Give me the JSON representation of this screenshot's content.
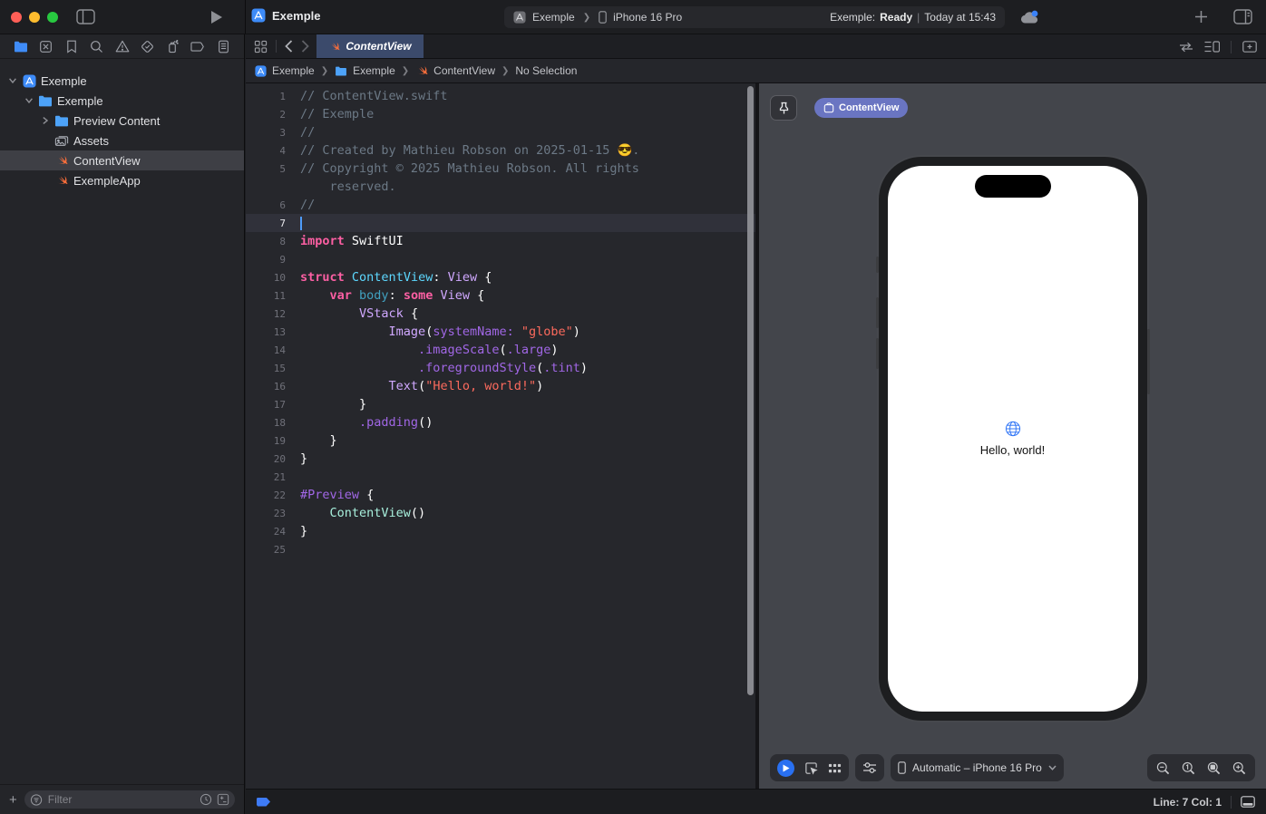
{
  "toolbar": {
    "project_title": "Exemple",
    "scheme_app": "Exemple",
    "scheme_chevron": "❯",
    "scheme_device": "iPhone 16 Pro",
    "status_project": "Exemple:",
    "status_state": "Ready",
    "status_sep": "|",
    "status_time": "Today at 15:43"
  },
  "navigator": {
    "icons": [
      "project-navigator-icon",
      "source-control-navigator-icon",
      "bookmarks-navigator-icon",
      "find-navigator-icon",
      "issues-navigator-icon",
      "tests-navigator-icon",
      "debug-navigator-icon",
      "breakpoints-navigator-icon",
      "reports-navigator-icon"
    ],
    "selected_index": 0
  },
  "sidebar": {
    "tree": [
      {
        "label": "Exemple",
        "icon": "app",
        "depth": 0,
        "chevron": "down",
        "selected": false
      },
      {
        "label": "Exemple",
        "icon": "folder",
        "depth": 1,
        "chevron": "down",
        "selected": false
      },
      {
        "label": "Preview Content",
        "icon": "folder",
        "depth": 2,
        "chevron": "right",
        "selected": false
      },
      {
        "label": "Assets",
        "icon": "assets",
        "depth": 2,
        "chevron": "",
        "selected": false
      },
      {
        "label": "ContentView",
        "icon": "swift",
        "depth": 2,
        "chevron": "",
        "selected": true
      },
      {
        "label": "ExempleApp",
        "icon": "swift",
        "depth": 2,
        "chevron": "",
        "selected": false
      }
    ],
    "filter_placeholder": "Filter"
  },
  "tabs": {
    "active_tab": "ContentView"
  },
  "jumpbar": {
    "items": [
      {
        "label": "Exemple",
        "icon": "app"
      },
      {
        "label": "Exemple",
        "icon": "folder"
      },
      {
        "label": "ContentView",
        "icon": "swift"
      },
      {
        "label": "No Selection",
        "icon": ""
      }
    ]
  },
  "editor": {
    "lines": [
      {
        "n": "1",
        "segs": [
          [
            "// ContentView.swift",
            "c"
          ]
        ]
      },
      {
        "n": "2",
        "segs": [
          [
            "// Exemple",
            "c"
          ]
        ]
      },
      {
        "n": "3",
        "segs": [
          [
            "//",
            "c"
          ]
        ]
      },
      {
        "n": "4",
        "segs": [
          [
            "// Created by Mathieu Robson on 2025-01-15 😎.",
            "c"
          ]
        ]
      },
      {
        "n": "5",
        "segs": [
          [
            "// Copyright © 2025 Mathieu Robson. All rights",
            "c"
          ]
        ]
      },
      {
        "n": "",
        "segs": [
          [
            "    reserved.",
            "c"
          ]
        ]
      },
      {
        "n": "6",
        "segs": [
          [
            "//",
            "c"
          ]
        ]
      },
      {
        "n": "7",
        "segs": [],
        "current": true
      },
      {
        "n": "8",
        "segs": [
          [
            "import",
            "k"
          ],
          [
            " SwiftUI",
            "w"
          ]
        ]
      },
      {
        "n": "9",
        "segs": []
      },
      {
        "n": "10",
        "segs": [
          [
            "struct",
            "k"
          ],
          [
            " ",
            "w"
          ],
          [
            "ContentView",
            "t"
          ],
          [
            ": ",
            "w"
          ],
          [
            "View",
            "p"
          ],
          [
            " {",
            "w"
          ]
        ]
      },
      {
        "n": "11",
        "segs": [
          [
            "    ",
            "w"
          ],
          [
            "var",
            "k"
          ],
          [
            " ",
            "w"
          ],
          [
            "body",
            "d"
          ],
          [
            ": ",
            "w"
          ],
          [
            "some",
            "k"
          ],
          [
            " ",
            "w"
          ],
          [
            "View",
            "p"
          ],
          [
            " {",
            "w"
          ]
        ]
      },
      {
        "n": "12",
        "segs": [
          [
            "        ",
            "w"
          ],
          [
            "VStack",
            "p"
          ],
          [
            " {",
            "w"
          ]
        ]
      },
      {
        "n": "13",
        "segs": [
          [
            "            ",
            "w"
          ],
          [
            "Image",
            "p"
          ],
          [
            "(",
            "w"
          ],
          [
            "systemName:",
            "m"
          ],
          [
            " ",
            "w"
          ],
          [
            "\"globe\"",
            "s"
          ],
          [
            ")",
            "w"
          ]
        ]
      },
      {
        "n": "14",
        "segs": [
          [
            "                ",
            "w"
          ],
          [
            ".imageScale",
            "m"
          ],
          [
            "(",
            "w"
          ],
          [
            ".large",
            "m"
          ],
          [
            ")",
            "w"
          ]
        ]
      },
      {
        "n": "15",
        "segs": [
          [
            "                ",
            "w"
          ],
          [
            ".foregroundStyle",
            "m"
          ],
          [
            "(",
            "w"
          ],
          [
            ".tint",
            "m"
          ],
          [
            ")",
            "w"
          ]
        ]
      },
      {
        "n": "16",
        "segs": [
          [
            "            ",
            "w"
          ],
          [
            "Text",
            "p"
          ],
          [
            "(",
            "w"
          ],
          [
            "\"Hello, world!\"",
            "s"
          ],
          [
            ")",
            "w"
          ]
        ]
      },
      {
        "n": "17",
        "segs": [
          [
            "        }",
            "w"
          ]
        ]
      },
      {
        "n": "18",
        "segs": [
          [
            "        ",
            "w"
          ],
          [
            ".padding",
            "m"
          ],
          [
            "()",
            "w"
          ]
        ]
      },
      {
        "n": "19",
        "segs": [
          [
            "    }",
            "w"
          ]
        ]
      },
      {
        "n": "20",
        "segs": [
          [
            "}",
            "w"
          ]
        ]
      },
      {
        "n": "21",
        "segs": []
      },
      {
        "n": "22",
        "segs": [
          [
            "#Preview",
            "m"
          ],
          [
            " {",
            "w"
          ]
        ]
      },
      {
        "n": "23",
        "segs": [
          [
            "    ",
            "w"
          ],
          [
            "ContentView",
            "g"
          ],
          [
            "()",
            "w"
          ]
        ]
      },
      {
        "n": "24",
        "segs": [
          [
            "}",
            "w"
          ]
        ]
      },
      {
        "n": "25",
        "segs": []
      }
    ]
  },
  "canvas": {
    "preview_pill": "ContentView",
    "device_selector": "Automatic – iPhone 16 Pro",
    "hello_text": "Hello, world!"
  },
  "status": {
    "line_col": "Line: 7  Col: 1"
  },
  "colors": {
    "accent_blue": "#3478f6",
    "swift_orange": "#f86e3b",
    "keyword_pink": "#fc5fa3",
    "string_red": "#fc6a5d",
    "comment_gray": "#6c7986",
    "tab_active": "#3b4a6b",
    "canvas_bg": "#43454b"
  }
}
